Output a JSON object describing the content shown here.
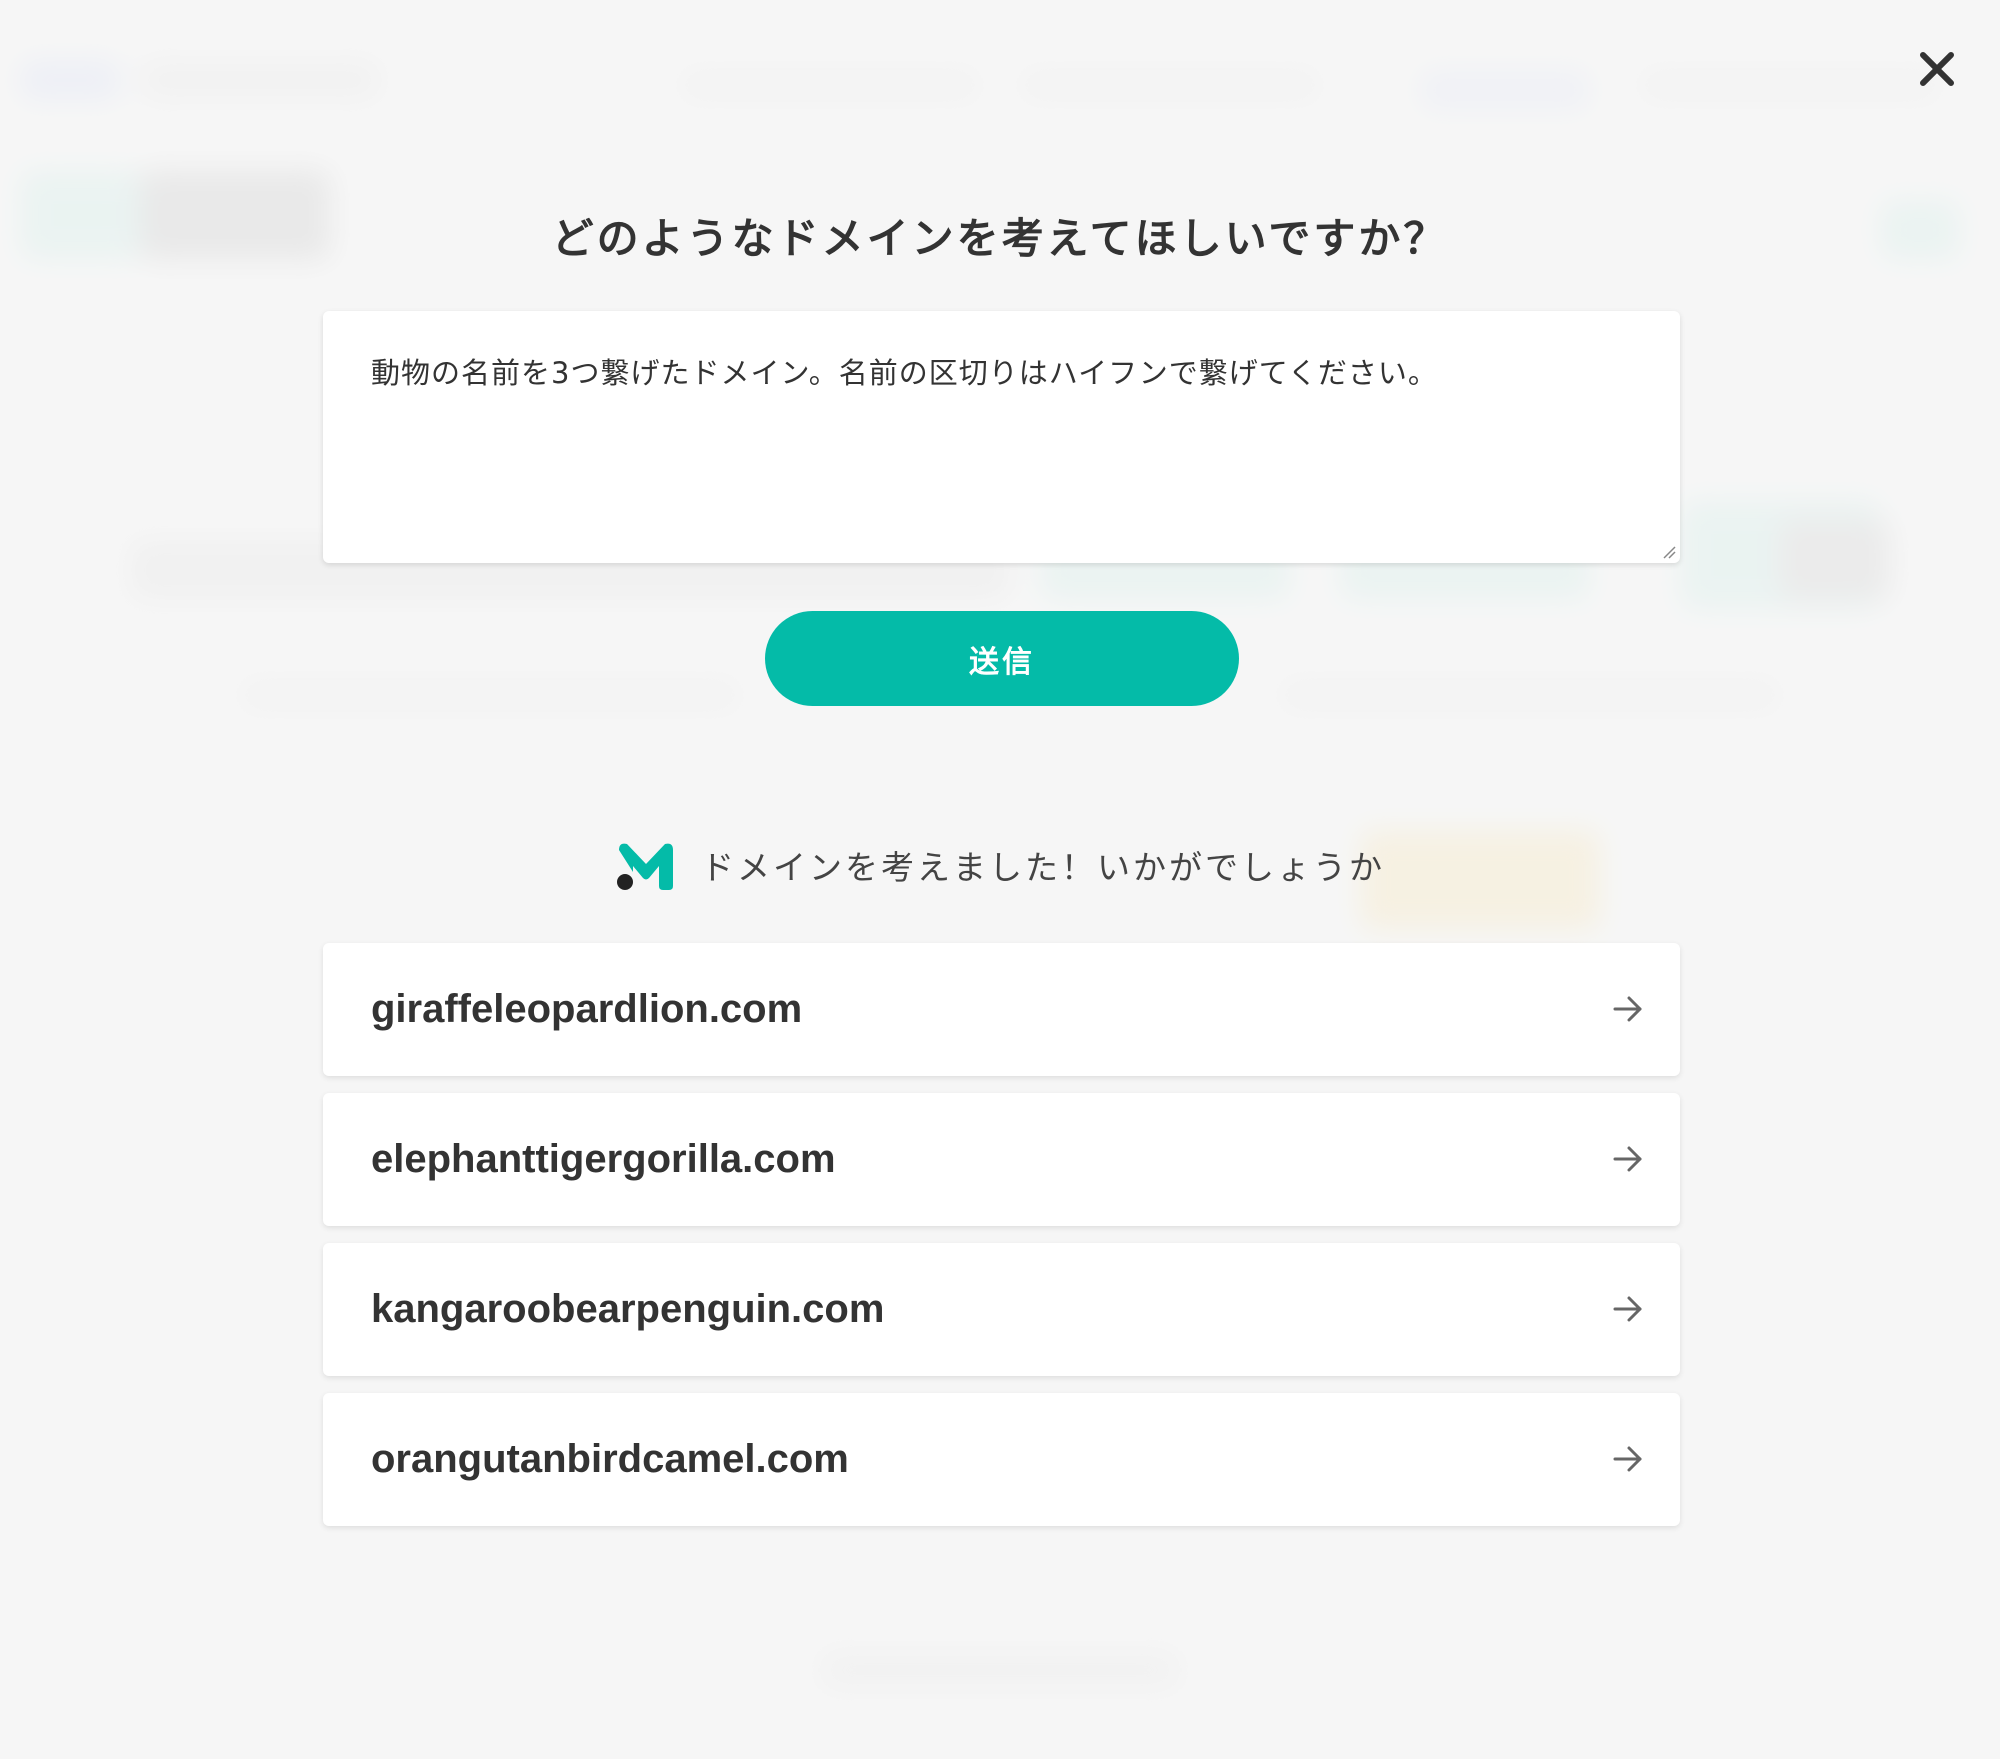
{
  "modal": {
    "title": "どのようなドメインを考えてほしいですか？",
    "prompt_value": "動物の名前を3つ繋げたドメイン。名前の区切りはハイフンで繋げてください。",
    "submit_label": "送信",
    "result_message": "ドメインを考えました！いかがでしょうか",
    "results": [
      {
        "domain": "giraffeleopardlion.com"
      },
      {
        "domain": "elephanttigergorilla.com"
      },
      {
        "domain": "kangaroobearpenguin.com"
      },
      {
        "domain": "orangutanbirdcamel.com"
      }
    ]
  },
  "icons": {
    "close": "close-icon",
    "logo": "m-logo-icon",
    "arrow": "arrow-right-icon",
    "resize": "resize-grip-icon"
  },
  "colors": {
    "accent": "#04bba8",
    "text": "#333333",
    "overlay": "#f5f5f5"
  }
}
